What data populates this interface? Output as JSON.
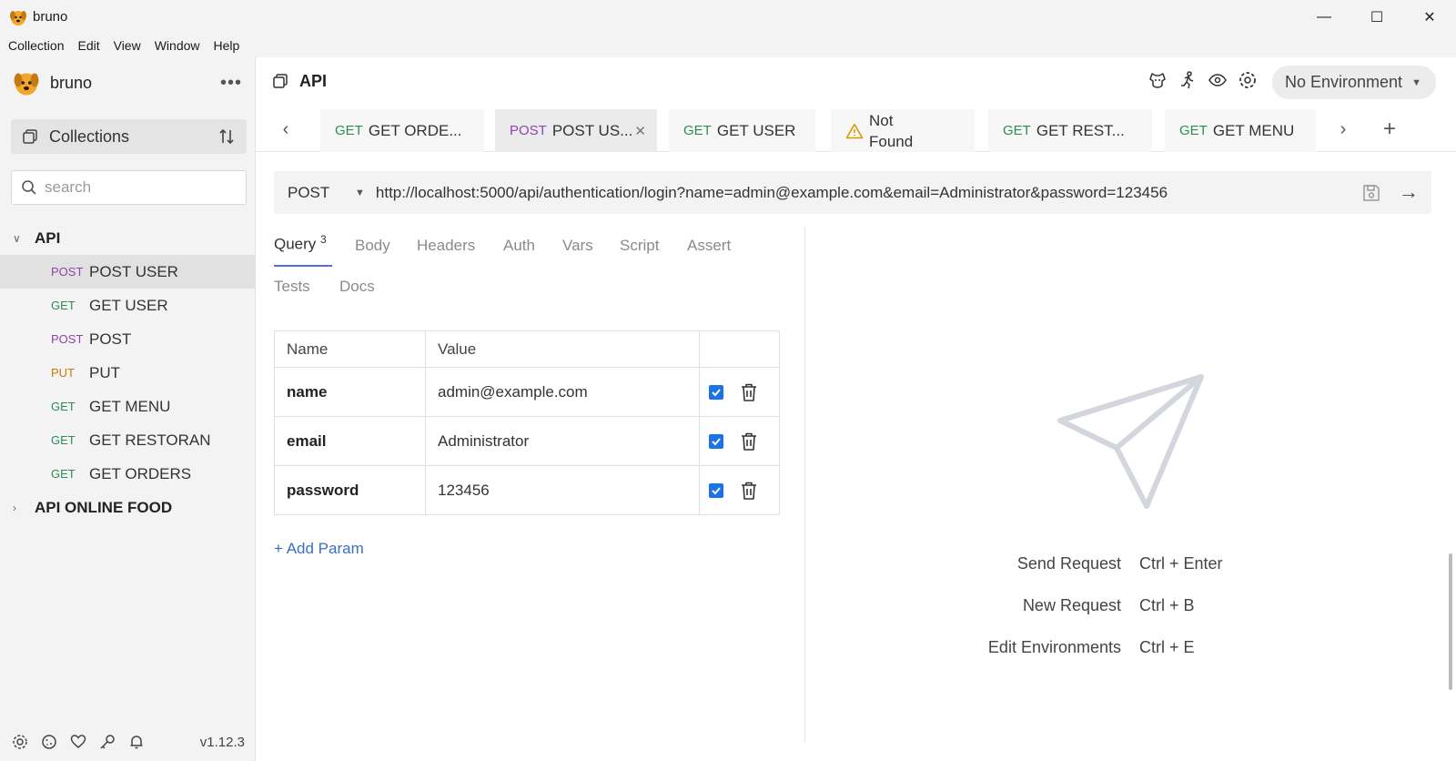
{
  "window": {
    "title": "bruno",
    "controls": {
      "minimize": "—",
      "maximize": "☐",
      "close": "✕"
    }
  },
  "menu": [
    "Collection",
    "Edit",
    "View",
    "Window",
    "Help"
  ],
  "sidebar": {
    "brand": "bruno",
    "more": "•••",
    "collections_label": "Collections",
    "search_placeholder": "search",
    "tree": [
      {
        "name": "API",
        "expanded": true,
        "requests": [
          {
            "method": "POST",
            "name": "POST USER",
            "active": true
          },
          {
            "method": "GET",
            "name": "GET USER"
          },
          {
            "method": "POST",
            "name": "POST"
          },
          {
            "method": "PUT",
            "name": "PUT"
          },
          {
            "method": "GET",
            "name": "GET MENU"
          },
          {
            "method": "GET",
            "name": "GET RESTORAN"
          },
          {
            "method": "GET",
            "name": "GET ORDERS"
          }
        ]
      },
      {
        "name": "API ONLINE FOOD",
        "expanded": false
      }
    ],
    "footer_icons": [
      "gear-icon",
      "cookie-icon",
      "heart-icon",
      "key-icon",
      "bell-icon"
    ],
    "version": "v1.12.3"
  },
  "header": {
    "collection_name": "API",
    "icons": [
      "dog-face-icon",
      "runner-icon",
      "eye-icon",
      "gear-icon"
    ],
    "environment": "No Environment"
  },
  "tabs": [
    {
      "method": "GET",
      "label": "GET ORDE..."
    },
    {
      "method": "POST",
      "label": "POST US...",
      "active": true,
      "close": "✕"
    },
    {
      "method": "GET",
      "label": "GET USER"
    },
    {
      "method": "",
      "label_line1": "Not",
      "label_line2": "Found",
      "warning": true
    },
    {
      "method": "GET",
      "label": "GET REST..."
    },
    {
      "method": "GET",
      "label": "GET MENU"
    }
  ],
  "request": {
    "method": "POST",
    "url": "http://localhost:5000/api/authentication/login?name=admin@example.com&email=Administrator&password=123456",
    "tabs": {
      "query": "Query",
      "query_count": "3",
      "body": "Body",
      "headers": "Headers",
      "auth": "Auth",
      "vars": "Vars",
      "script": "Script",
      "assert": "Assert",
      "tests": "Tests",
      "docs": "Docs"
    },
    "params_columns": [
      "Name",
      "Value"
    ],
    "params": [
      {
        "name": "name",
        "value": "admin@example.com",
        "enabled": true
      },
      {
        "name": "email",
        "value": "Administrator",
        "enabled": true
      },
      {
        "name": "password",
        "value": "123456",
        "enabled": true
      }
    ],
    "add_param": "+ Add Param"
  },
  "response": {
    "shortcuts": [
      {
        "label": "Send Request",
        "keys": "Ctrl + Enter"
      },
      {
        "label": "New Request",
        "keys": "Ctrl + B"
      },
      {
        "label": "Edit Environments",
        "keys": "Ctrl + E"
      }
    ]
  },
  "colors": {
    "get": "#2e8b57",
    "post": "#8e44ad",
    "put": "#c77c00",
    "accent": "#546de5",
    "link": "#3b6fc4",
    "checkbox": "#1a73e8"
  }
}
